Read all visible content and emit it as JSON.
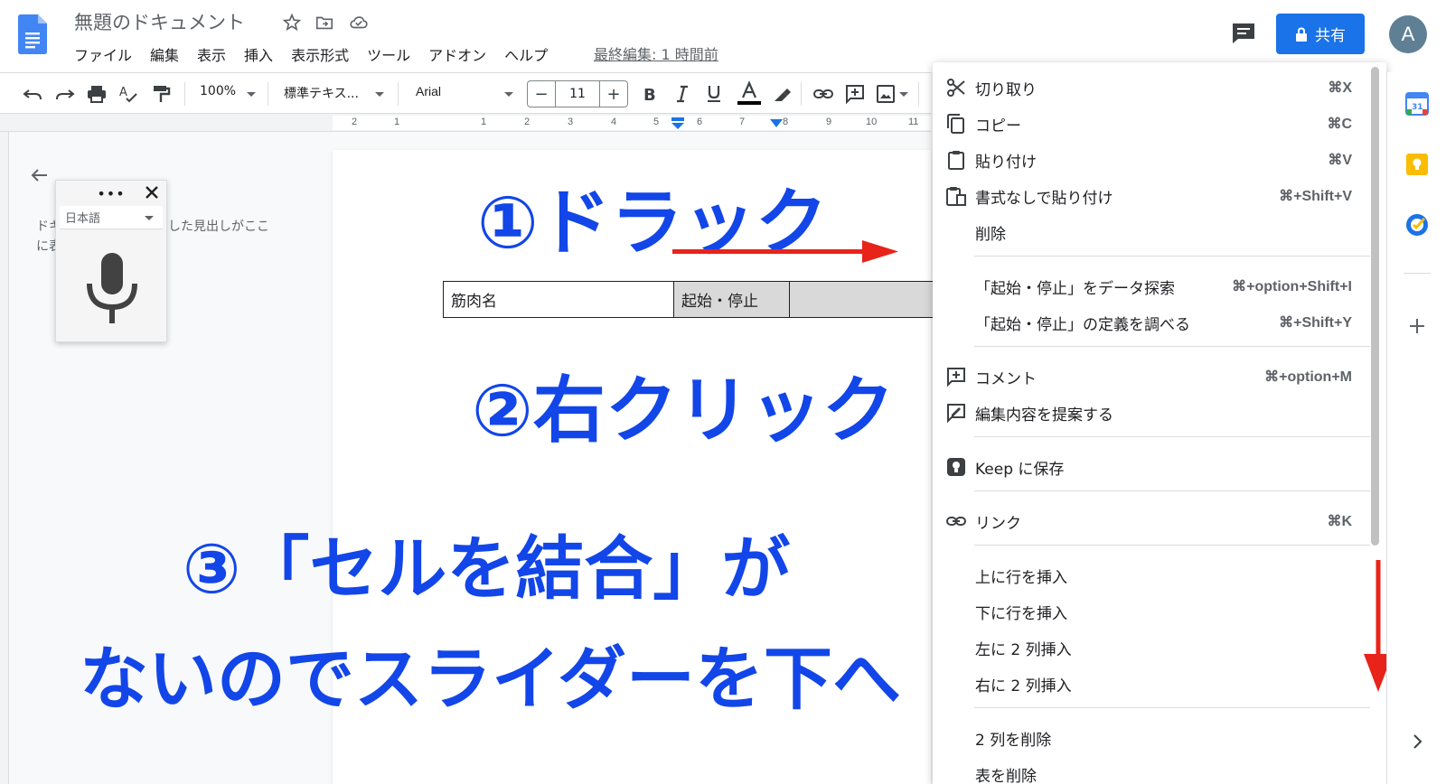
{
  "header": {
    "doc_title": "無題のドキュメント",
    "menus": [
      "ファイル",
      "編集",
      "表示",
      "挿入",
      "表示形式",
      "ツール",
      "アドオン",
      "ヘルプ"
    ],
    "last_edit": "最終編集: 1 時間前",
    "share_label": "共有",
    "avatar_letter": "A"
  },
  "toolbar": {
    "zoom": "100%",
    "style": "標準テキス...",
    "font": "Arial",
    "font_size": "11",
    "minus": "−",
    "plus": "+"
  },
  "ruler": {
    "numbers": [
      "2",
      "1",
      "1",
      "2",
      "3",
      "4",
      "5",
      "6",
      "7",
      "8",
      "9",
      "10",
      "11"
    ]
  },
  "outline": {
    "text_line1": "ドキ",
    "text_line1_tail": "した見出しがここ",
    "text_line2": "に表"
  },
  "voice": {
    "dots": "•••",
    "language": "日本語"
  },
  "table": {
    "cells": [
      "筋肉名",
      "起始・停止",
      ""
    ]
  },
  "annotations": {
    "step1": "①ドラック",
    "step2": "②右クリック",
    "step3": "③「セルを結合」が",
    "step4": "ないのでスライダーを下へ"
  },
  "context_menu": {
    "items": [
      {
        "label": "切り取り",
        "shortcut": "⌘X",
        "icon": "scissors-icon"
      },
      {
        "label": "コピー",
        "shortcut": "⌘C",
        "icon": "copy-icon"
      },
      {
        "label": "貼り付け",
        "shortcut": "⌘V",
        "icon": "clipboard-icon"
      },
      {
        "label": "書式なしで貼り付け",
        "shortcut": "⌘+Shift+V",
        "icon": "paste-plain-icon"
      },
      {
        "label": "削除",
        "shortcut": "",
        "icon": ""
      },
      {
        "label": "「起始・停止」をデータ探索",
        "shortcut": "⌘+option+Shift+I",
        "icon": ""
      },
      {
        "label": "「起始・停止」の定義を調べる",
        "shortcut": "⌘+Shift+Y",
        "icon": ""
      },
      {
        "label": "コメント",
        "shortcut": "⌘+option+M",
        "icon": "add-comment-icon"
      },
      {
        "label": "編集内容を提案する",
        "shortcut": "",
        "icon": "suggest-edit-icon"
      },
      {
        "label": "Keep に保存",
        "shortcut": "",
        "icon": "keep-icon"
      },
      {
        "label": "リンク",
        "shortcut": "⌘K",
        "icon": "link-icon"
      },
      {
        "label": "上に行を挿入",
        "shortcut": "",
        "icon": ""
      },
      {
        "label": "下に行を挿入",
        "shortcut": "",
        "icon": ""
      },
      {
        "label": "左に 2 列挿入",
        "shortcut": "",
        "icon": ""
      },
      {
        "label": "右に 2 列挿入",
        "shortcut": "",
        "icon": ""
      },
      {
        "label": "2 列を削除",
        "shortcut": "",
        "icon": ""
      },
      {
        "label": "表を削除",
        "shortcut": "",
        "icon": ""
      }
    ]
  },
  "colors": {
    "accent": "#1a73e8",
    "annotation_blue": "#1246e8",
    "arrow_red": "#e8231a"
  }
}
